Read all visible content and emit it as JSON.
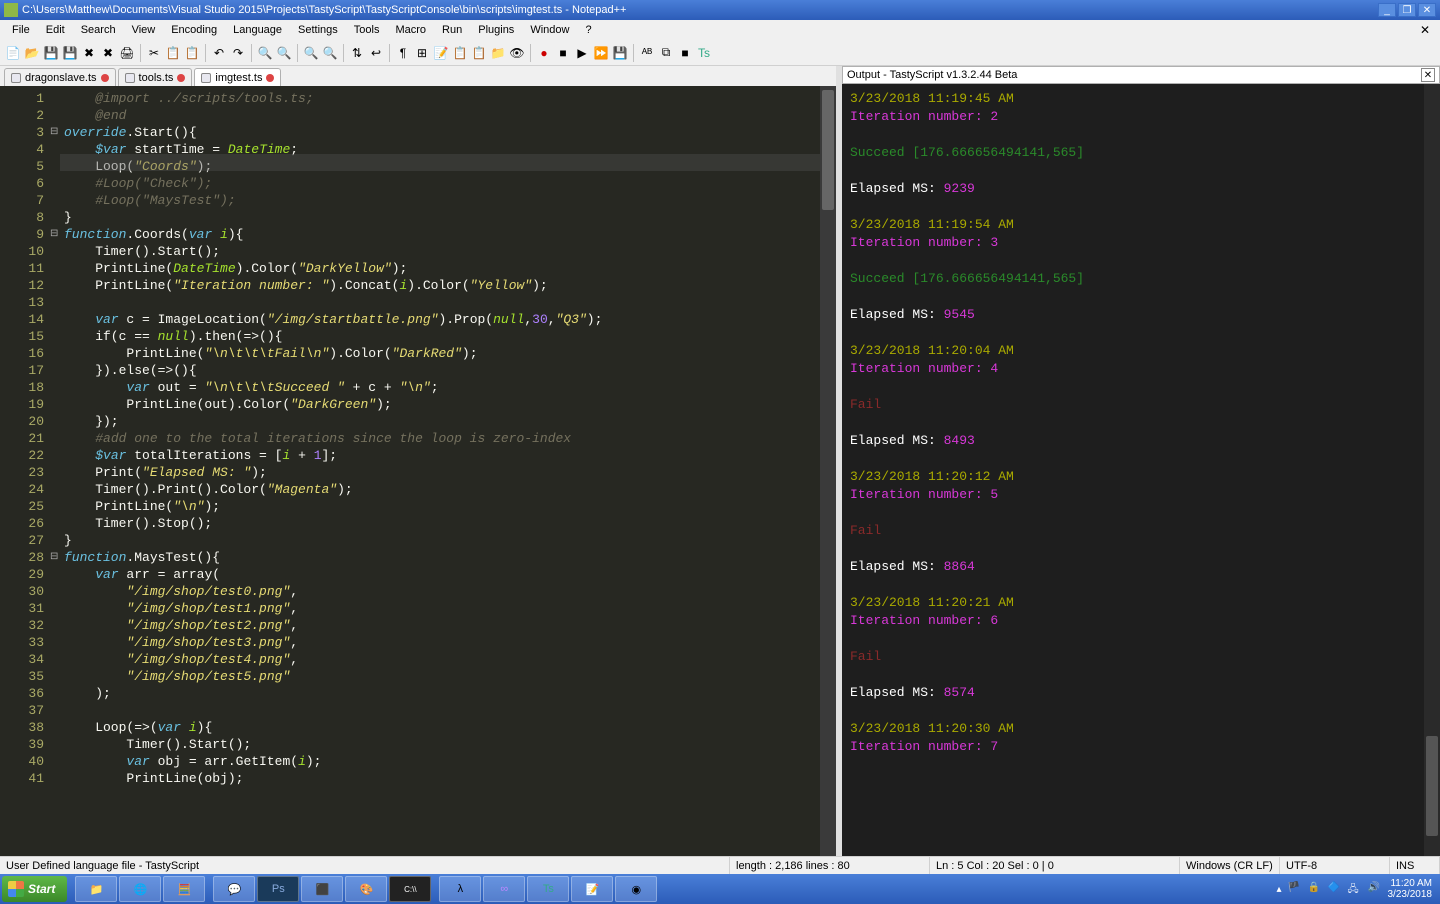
{
  "window": {
    "title": "C:\\Users\\Matthew\\Documents\\Visual Studio 2015\\Projects\\TastyScript\\TastyScriptConsole\\bin\\scripts\\imgtest.ts - Notepad++"
  },
  "menus": [
    "File",
    "Edit",
    "Search",
    "View",
    "Encoding",
    "Language",
    "Settings",
    "Tools",
    "Macro",
    "Run",
    "Plugins",
    "Window",
    "?"
  ],
  "tabs": [
    {
      "label": "dragonslave.ts",
      "active": false
    },
    {
      "label": "tools.ts",
      "active": false
    },
    {
      "label": "imgtest.ts",
      "active": true
    }
  ],
  "status": {
    "lang": "User Defined language file - TastyScript",
    "length": "length : 2,186    lines : 80",
    "pos": "Ln : 5   Col : 20   Sel : 0 | 0",
    "eol": "Windows (CR LF)",
    "enc": "UTF-8",
    "mode": "INS"
  },
  "output_title": "Output - TastyScript v1.3.2.44 Beta",
  "output_lines": [
    {
      "cls": "yellow",
      "text": "3/23/2018 11:19:45 AM"
    },
    {
      "cls": "magenta",
      "text": "Iteration number: 2"
    },
    {
      "cls": "",
      "text": ""
    },
    {
      "cls": "green",
      "text": "                  Succeed [176.666656494141,565]"
    },
    {
      "cls": "",
      "text": ""
    },
    {
      "cls": "white",
      "text": "Elapsed MS: 9239",
      "valcls": "magenta"
    },
    {
      "cls": "",
      "text": ""
    },
    {
      "cls": "yellow",
      "text": "3/23/2018 11:19:54 AM"
    },
    {
      "cls": "magenta",
      "text": "Iteration number: 3"
    },
    {
      "cls": "",
      "text": ""
    },
    {
      "cls": "green",
      "text": "                  Succeed [176.666656494141,565]"
    },
    {
      "cls": "",
      "text": ""
    },
    {
      "cls": "white",
      "text": "Elapsed MS: 9545",
      "valcls": "magenta"
    },
    {
      "cls": "",
      "text": ""
    },
    {
      "cls": "yellow",
      "text": "3/23/2018 11:20:04 AM"
    },
    {
      "cls": "magenta",
      "text": "Iteration number: 4"
    },
    {
      "cls": "",
      "text": ""
    },
    {
      "cls": "red",
      "text": "                  Fail"
    },
    {
      "cls": "",
      "text": ""
    },
    {
      "cls": "white",
      "text": "Elapsed MS: 8493",
      "valcls": "magenta"
    },
    {
      "cls": "",
      "text": ""
    },
    {
      "cls": "yellow",
      "text": "3/23/2018 11:20:12 AM"
    },
    {
      "cls": "magenta",
      "text": "Iteration number: 5"
    },
    {
      "cls": "",
      "text": ""
    },
    {
      "cls": "red",
      "text": "                  Fail"
    },
    {
      "cls": "",
      "text": ""
    },
    {
      "cls": "white",
      "text": "Elapsed MS: 8864",
      "valcls": "magenta"
    },
    {
      "cls": "",
      "text": ""
    },
    {
      "cls": "yellow",
      "text": "3/23/2018 11:20:21 AM"
    },
    {
      "cls": "magenta",
      "text": "Iteration number: 6"
    },
    {
      "cls": "",
      "text": ""
    },
    {
      "cls": "red",
      "text": "                  Fail"
    },
    {
      "cls": "",
      "text": ""
    },
    {
      "cls": "white",
      "text": "Elapsed MS: 8574",
      "valcls": "magenta"
    },
    {
      "cls": "",
      "text": ""
    },
    {
      "cls": "yellow",
      "text": "3/23/2018 11:20:30 AM"
    },
    {
      "cls": "magenta",
      "text": "Iteration number: 7"
    }
  ],
  "taskbar": {
    "start": "Start",
    "time": "11:20 AM",
    "date": "3/23/2018"
  },
  "code": [
    {
      "n": 1,
      "fold": "",
      "html": "    <span class='c-com'>@import ../scripts/tools.ts;</span>"
    },
    {
      "n": 2,
      "fold": "",
      "html": "    <span class='c-com'>@end</span>"
    },
    {
      "n": 3,
      "fold": "⊟",
      "html": "<span class='c-kw'>override</span>.Start(){"
    },
    {
      "n": 4,
      "fold": "",
      "html": "    <span class='c-kw'>$var</span> startTime = <span class='c-var'>DateTime</span>;"
    },
    {
      "n": 5,
      "fold": "",
      "html": "    Loop(<span class='c-str'>\"Coords\"</span>);",
      "current": true
    },
    {
      "n": 6,
      "fold": "",
      "html": "    <span class='c-com'>#Loop(\"Check\");</span>"
    },
    {
      "n": 7,
      "fold": "",
      "html": "    <span class='c-com'>#Loop(\"MaysTest\");</span>"
    },
    {
      "n": 8,
      "fold": "",
      "html": "}"
    },
    {
      "n": 9,
      "fold": "⊟",
      "html": "<span class='c-kw'>function</span>.Coords(<span class='c-kw'>var</span> <span class='c-var'>i</span>){"
    },
    {
      "n": 10,
      "fold": "",
      "html": "    Timer().Start();"
    },
    {
      "n": 11,
      "fold": "",
      "html": "    PrintLine(<span class='c-var'>DateTime</span>).Color(<span class='c-str'>\"DarkYellow\"</span>);"
    },
    {
      "n": 12,
      "fold": "",
      "html": "    PrintLine(<span class='c-str'>\"Iteration number: \"</span>).Concat(<span class='c-var'>i</span>).Color(<span class='c-str'>\"Yellow\"</span>);"
    },
    {
      "n": 13,
      "fold": "",
      "html": ""
    },
    {
      "n": 14,
      "fold": "",
      "html": "    <span class='c-kw'>var</span> c = ImageLocation(<span class='c-str'>\"/img/startbattle.png\"</span>).Prop(<span class='c-var'>null</span>,<span class='c-num'>30</span>,<span class='c-str'>\"Q3\"</span>);"
    },
    {
      "n": 15,
      "fold": "",
      "html": "    if(c == <span class='c-var'>null</span>).then(=&gt;(){"
    },
    {
      "n": 16,
      "fold": "",
      "html": "        PrintLine(<span class='c-str'>\"\\n\\t\\t\\tFail\\n\"</span>).Color(<span class='c-str'>\"DarkRed\"</span>);"
    },
    {
      "n": 17,
      "fold": "",
      "html": "    }).else(=&gt;(){"
    },
    {
      "n": 18,
      "fold": "",
      "html": "        <span class='c-kw'>var</span> out = <span class='c-str'>\"\\n\\t\\t\\tSucceed \"</span> + c + <span class='c-str'>\"\\n\"</span>;"
    },
    {
      "n": 19,
      "fold": "",
      "html": "        PrintLine(out).Color(<span class='c-str'>\"DarkGreen\"</span>);"
    },
    {
      "n": 20,
      "fold": "",
      "html": "    });"
    },
    {
      "n": 21,
      "fold": "",
      "html": "    <span class='c-com'>#add one to the total iterations since the loop is zero-index</span>"
    },
    {
      "n": 22,
      "fold": "",
      "html": "    <span class='c-kw'>$var</span> totalIterations = [<span class='c-var'>i</span> + <span class='c-num'>1</span>];"
    },
    {
      "n": 23,
      "fold": "",
      "html": "    Print(<span class='c-str'>\"Elapsed MS: \"</span>);"
    },
    {
      "n": 24,
      "fold": "",
      "html": "    Timer().Print().Color(<span class='c-str'>\"Magenta\"</span>);"
    },
    {
      "n": 25,
      "fold": "",
      "html": "    PrintLine(<span class='c-str'>\"\\n\"</span>);"
    },
    {
      "n": 26,
      "fold": "",
      "html": "    Timer().Stop();"
    },
    {
      "n": 27,
      "fold": "",
      "html": "}"
    },
    {
      "n": 28,
      "fold": "⊟",
      "html": "<span class='c-kw'>function</span>.MaysTest(){"
    },
    {
      "n": 29,
      "fold": "",
      "html": "    <span class='c-kw'>var</span> arr = array("
    },
    {
      "n": 30,
      "fold": "",
      "html": "        <span class='c-str'>\"/img/shop/test0.png\"</span>,"
    },
    {
      "n": 31,
      "fold": "",
      "html": "        <span class='c-str'>\"/img/shop/test1.png\"</span>,"
    },
    {
      "n": 32,
      "fold": "",
      "html": "        <span class='c-str'>\"/img/shop/test2.png\"</span>,"
    },
    {
      "n": 33,
      "fold": "",
      "html": "        <span class='c-str'>\"/img/shop/test3.png\"</span>,"
    },
    {
      "n": 34,
      "fold": "",
      "html": "        <span class='c-str'>\"/img/shop/test4.png\"</span>,"
    },
    {
      "n": 35,
      "fold": "",
      "html": "        <span class='c-str'>\"/img/shop/test5.png\"</span>"
    },
    {
      "n": 36,
      "fold": "",
      "html": "    );"
    },
    {
      "n": 37,
      "fold": "",
      "html": ""
    },
    {
      "n": 38,
      "fold": "",
      "html": "    Loop(=&gt;(<span class='c-kw'>var</span> <span class='c-var'>i</span>){"
    },
    {
      "n": 39,
      "fold": "",
      "html": "        Timer().Start();"
    },
    {
      "n": 40,
      "fold": "",
      "html": "        <span class='c-kw'>var</span> obj = arr.GetItem(<span class='c-var'>i</span>);"
    },
    {
      "n": 41,
      "fold": "",
      "html": "        PrintLine(obj);"
    }
  ]
}
